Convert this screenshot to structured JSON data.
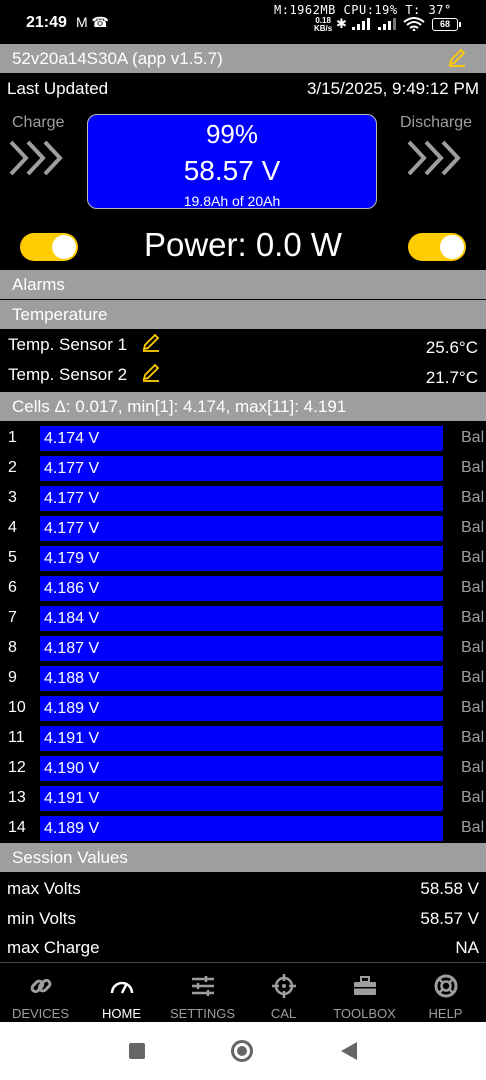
{
  "status_bar": {
    "time": "21:49",
    "notif_icons": "M ☎",
    "info": "M:1962MB  CPU:19%   T: 37°",
    "speed_value": "0.18",
    "speed_unit": "KB/s",
    "battery": "68"
  },
  "device": {
    "title": "52v20a14S30A (app v1.5.7)"
  },
  "updated": {
    "label": "Last Updated",
    "value": "3/15/2025, 9:49:12 PM"
  },
  "charge": {
    "label": "Charge"
  },
  "discharge": {
    "label": "Discharge"
  },
  "soc": {
    "percent": "99%",
    "voltage": "58.57 V",
    "capacity": "19.8Ah of 20Ah"
  },
  "power": {
    "text": "Power: 0.0 W"
  },
  "sections": {
    "alarms": "Alarms",
    "temperature": "Temperature",
    "session": "Session Values"
  },
  "temperatures": [
    {
      "label": "Temp. Sensor 1",
      "value": "25.6°C"
    },
    {
      "label": "Temp. Sensor 2",
      "value": "21.7°C"
    }
  ],
  "cells_header": "Cells Δ: 0.017, min[1]: 4.174, max[11]: 4.191",
  "cells": [
    {
      "num": "1",
      "voltage": "4.174 V",
      "bal": "Bal"
    },
    {
      "num": "2",
      "voltage": "4.177 V",
      "bal": "Bal"
    },
    {
      "num": "3",
      "voltage": "4.177 V",
      "bal": "Bal"
    },
    {
      "num": "4",
      "voltage": "4.177 V",
      "bal": "Bal"
    },
    {
      "num": "5",
      "voltage": "4.179 V",
      "bal": "Bal"
    },
    {
      "num": "6",
      "voltage": "4.186 V",
      "bal": "Bal"
    },
    {
      "num": "7",
      "voltage": "4.184 V",
      "bal": "Bal"
    },
    {
      "num": "8",
      "voltage": "4.187 V",
      "bal": "Bal"
    },
    {
      "num": "9",
      "voltage": "4.188 V",
      "bal": "Bal"
    },
    {
      "num": "10",
      "voltage": "4.189 V",
      "bal": "Bal"
    },
    {
      "num": "11",
      "voltage": "4.191 V",
      "bal": "Bal"
    },
    {
      "num": "12",
      "voltage": "4.190 V",
      "bal": "Bal"
    },
    {
      "num": "13",
      "voltage": "4.191 V",
      "bal": "Bal"
    },
    {
      "num": "14",
      "voltage": "4.189 V",
      "bal": "Bal"
    }
  ],
  "session": [
    {
      "label": "max Volts",
      "value": "58.58 V"
    },
    {
      "label": "min Volts",
      "value": "58.57 V"
    },
    {
      "label": "max Charge",
      "value": "NA"
    }
  ],
  "nav": [
    {
      "label": "DEVICES",
      "icon": "link-icon"
    },
    {
      "label": "HOME",
      "icon": "gauge-icon"
    },
    {
      "label": "SETTINGS",
      "icon": "sliders-icon"
    },
    {
      "label": "CAL",
      "icon": "crosshair-icon"
    },
    {
      "label": "TOOLBOX",
      "icon": "toolbox-icon"
    },
    {
      "label": "HELP",
      "icon": "lifebuoy-icon"
    }
  ],
  "colors": {
    "accent_blue": "#0000ff",
    "toggle_yellow": "#ffcc00",
    "header_gray": "#9e9e9e",
    "edit_icon_yellow": "#ffcc00"
  }
}
